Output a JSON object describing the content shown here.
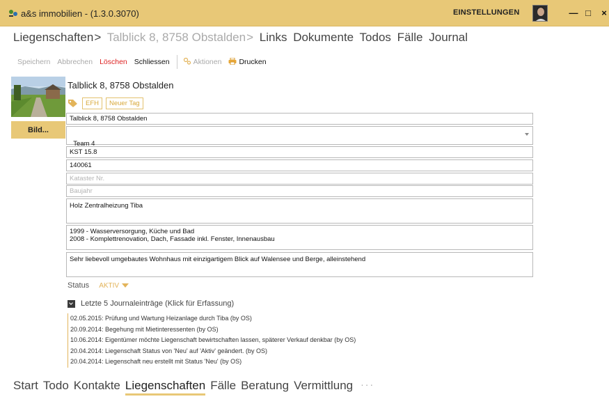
{
  "window": {
    "title": "a&s immobilien - (1.3.0.3070)",
    "settings_label": "EINSTELLUNGEN",
    "minimize_glyph": "—",
    "maximize_glyph": "□",
    "close_glyph": "×",
    "accent": "#e8c877"
  },
  "breadcrumb": {
    "items": [
      {
        "label": "Liegenschaften",
        "muted": false
      },
      {
        "label": ">",
        "muted": false
      },
      {
        "label": "Talblick 8, 8758 Obstalden",
        "muted": true
      },
      {
        "label": ">",
        "muted": true
      },
      {
        "label": "Links",
        "muted": false
      },
      {
        "label": "Dokumente",
        "muted": false
      },
      {
        "label": "Todos",
        "muted": false
      },
      {
        "label": "Fälle",
        "muted": false
      },
      {
        "label": "Journal",
        "muted": false
      }
    ]
  },
  "toolbar": {
    "save_label": "Speichern",
    "cancel_label": "Abbrechen",
    "delete_label": "Löschen",
    "close_label": "Schliessen",
    "actions_label": "Aktionen",
    "print_label": "Drucken"
  },
  "image": {
    "button_label": "Bild..."
  },
  "property": {
    "title": "Talblick 8, 8758 Obstalden",
    "tags": [
      "EFH",
      "Neuer Tag"
    ],
    "address": "Talblick 8, 8758 Obstalden",
    "team": "Team 4",
    "kst": "KST 15.8",
    "number": "140061",
    "kataster_placeholder": "Kataster Nr.",
    "baujahr_placeholder": "Baujahr",
    "heating": "Holz Zentralheizung Tiba",
    "renovations": "1999 - Wasserversorgung, Küche und Bad\n2008 - Komplettrenovation, Dach, Fassade inkl. Fenster, Innenausbau",
    "description": "Sehr liebevoll umgebautes Wohnhaus mit einzigartigem Blick auf Walensee und Berge, alleinstehend"
  },
  "status": {
    "label": "Status",
    "value": "AKTIV"
  },
  "journal": {
    "heading": "Letzte 5 Journaleinträge (Klick für Erfassung)",
    "entries": [
      "02.05.2015: Prüfung und Wartung Heizanlage durch Tiba (by OS)",
      "20.09.2014: Begehung mit Mietinteressenten (by OS)",
      "10.06.2014: Eigentümer möchte Liegenschaft bewirtschaften lassen, späterer Verkauf denkbar (by OS)",
      "20.04.2014: Liegenschaft Status von 'Neu' auf 'Aktiv' geändert. (by OS)",
      "20.04.2014: Liegenschaft neu erstellt mit Status 'Neu' (by OS)"
    ]
  },
  "bottom_nav": {
    "items": [
      "Start",
      "Todo",
      "Kontakte",
      "Liegenschaften",
      "Fälle",
      "Beratung",
      "Vermittlung"
    ],
    "active": "Liegenschaften",
    "more": "···"
  }
}
